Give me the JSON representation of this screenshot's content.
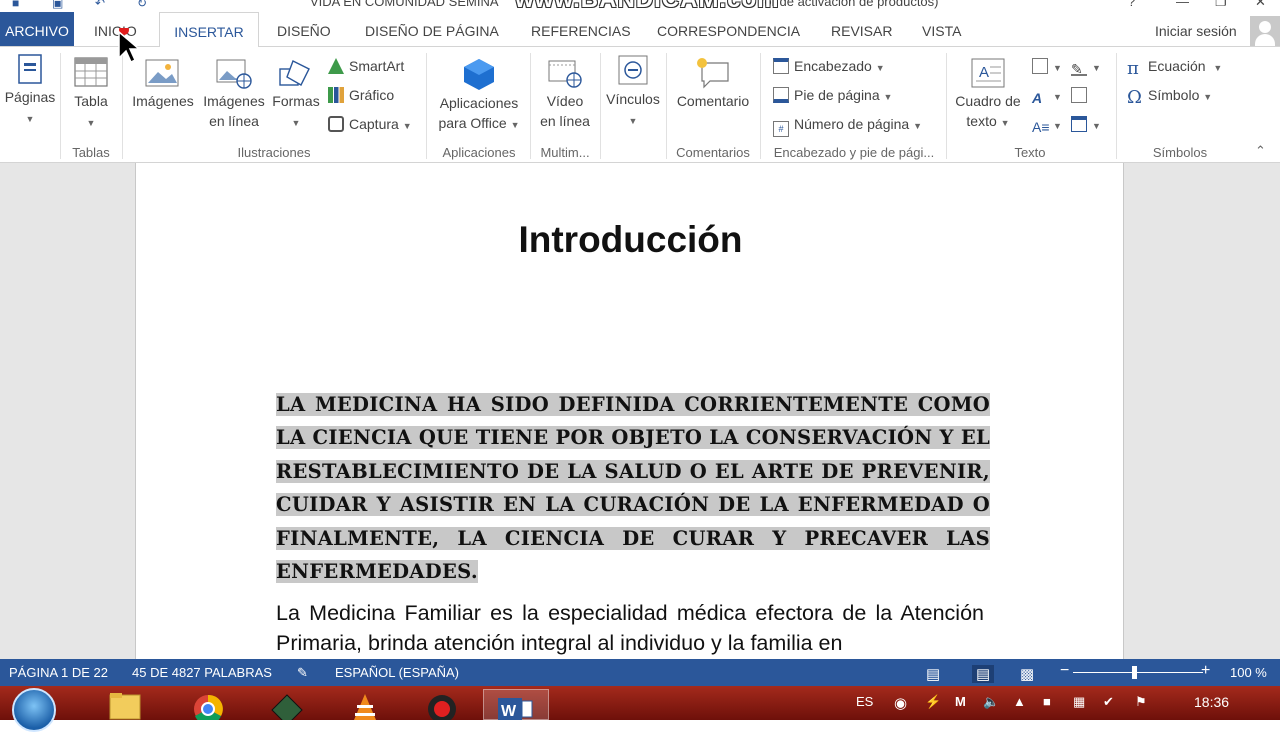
{
  "window": {
    "title": "VIDA EN COMUNIDAD SEMINA",
    "title_suffix": "ror de activación de productos)",
    "watermark": "www.BANDICAM.com"
  },
  "tabs": {
    "archivo": "ARCHIVO",
    "inicio": "INICIO",
    "insertar": "INSERTAR",
    "diseno": "DISEÑO",
    "diseno_pagina": "DISEÑO DE PÁGINA",
    "referencias": "REFERENCIAS",
    "correspondencia": "CORRESPONDENCIA",
    "revisar": "REVISAR",
    "vista": "VISTA",
    "active": "INSERTAR"
  },
  "account": {
    "signin": "Iniciar sesión"
  },
  "ribbon": {
    "paginas": "Páginas",
    "tabla": "Tabla",
    "imagenes": "Imágenes",
    "imagenes_linea_1": "Imágenes",
    "imagenes_linea_2": "en línea",
    "formas": "Formas",
    "smartart": "SmartArt",
    "grafico": "Gráfico",
    "captura": "Captura",
    "aplicaciones_1": "Aplicaciones",
    "aplicaciones_2": "para Office",
    "video_1": "Vídeo",
    "video_2": "en línea",
    "vinculos": "Vínculos",
    "comentario": "Comentario",
    "encabezado": "Encabezado",
    "pie_pagina": "Pie de página",
    "numero_pagina": "Número de página",
    "cuadro_texto_1": "Cuadro de",
    "cuadro_texto_2": "texto",
    "ecuacion": "Ecuación",
    "simbolo": "Símbolo",
    "groups": {
      "tablas": "Tablas",
      "ilustraciones": "Ilustraciones",
      "aplicaciones": "Aplicaciones",
      "multimedia": "Multim...",
      "comentarios": "Comentarios",
      "encabezado_pie": "Encabezado y pie de pági...",
      "texto": "Texto",
      "simbolos": "Símbolos"
    }
  },
  "document": {
    "title": "Introducción",
    "paragraph1": "LA MEDICINA HA SIDO DEFINIDA CORRIENTEMENTE COMO LA CIENCIA QUE TIENE POR OBJETO LA CONSERVACIÓN Y EL RESTABLECIMIENTO DE LA SALUD O EL ARTE DE PREVENIR, CUIDAR Y ASISTIR EN LA CURACIÓN DE LA ENFERMEDAD O FINALMENTE, LA CIENCIA DE CURAR Y PRECAVER LAS ENFERMEDADES.",
    "paragraph2": "La Medicina Familiar es la especialidad médica efectora de la Atención Primaria, brinda atención integral al individuo y la familia en"
  },
  "status": {
    "page": "PÁGINA 1 DE 22",
    "words": "45 DE 4827 PALABRAS",
    "language": "ESPAÑOL (ESPAÑA)",
    "zoom": "100 %",
    "zoom_minus": "−",
    "zoom_plus": "+"
  },
  "taskbar": {
    "lang": "ES",
    "time": "18:36"
  }
}
